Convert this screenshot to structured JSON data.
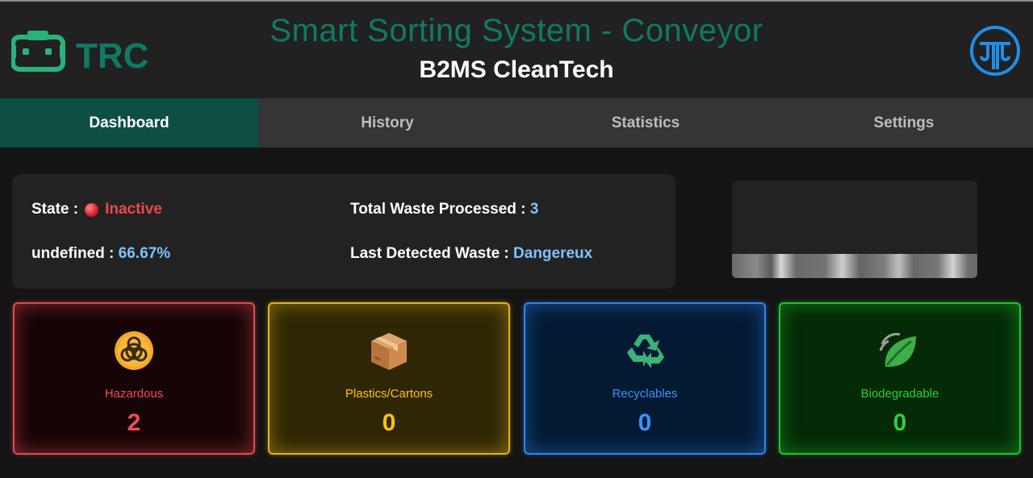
{
  "header": {
    "title": "Smart Sorting System - Conveyor",
    "subtitle": "B2MS CleanTech",
    "left_logo_text": "TRC",
    "left_logo_icon": "robot-head-icon",
    "right_logo_icon": "circuit-logo-icon",
    "accent_color": "#0f7a63"
  },
  "nav": {
    "tabs": [
      {
        "label": "Dashboard",
        "active": true
      },
      {
        "label": "History",
        "active": false
      },
      {
        "label": "Statistics",
        "active": false
      },
      {
        "label": "Settings",
        "active": false
      }
    ]
  },
  "status": {
    "state_label": "State :",
    "state_value": "Inactive",
    "state_color": "#e84a4a",
    "metric_label": "undefined :",
    "metric_value": "66.67%",
    "total_label": "Total Waste Processed :",
    "total_value": "3",
    "last_label": "Last Detected Waste :",
    "last_value": "Dangereux"
  },
  "categories": [
    {
      "label": "Hazardous",
      "count": "2",
      "icon": "biohazard-icon",
      "color": "#ef4c52"
    },
    {
      "label": "Plastics/Cartons",
      "count": "0",
      "icon": "package-icon",
      "color": "#ffc20e"
    },
    {
      "label": "Recyclables",
      "count": "0",
      "icon": "recycle-icon",
      "color": "#3a93ff"
    },
    {
      "label": "Biodegradable",
      "count": "0",
      "icon": "leaf-icon",
      "color": "#2bd13a"
    }
  ]
}
